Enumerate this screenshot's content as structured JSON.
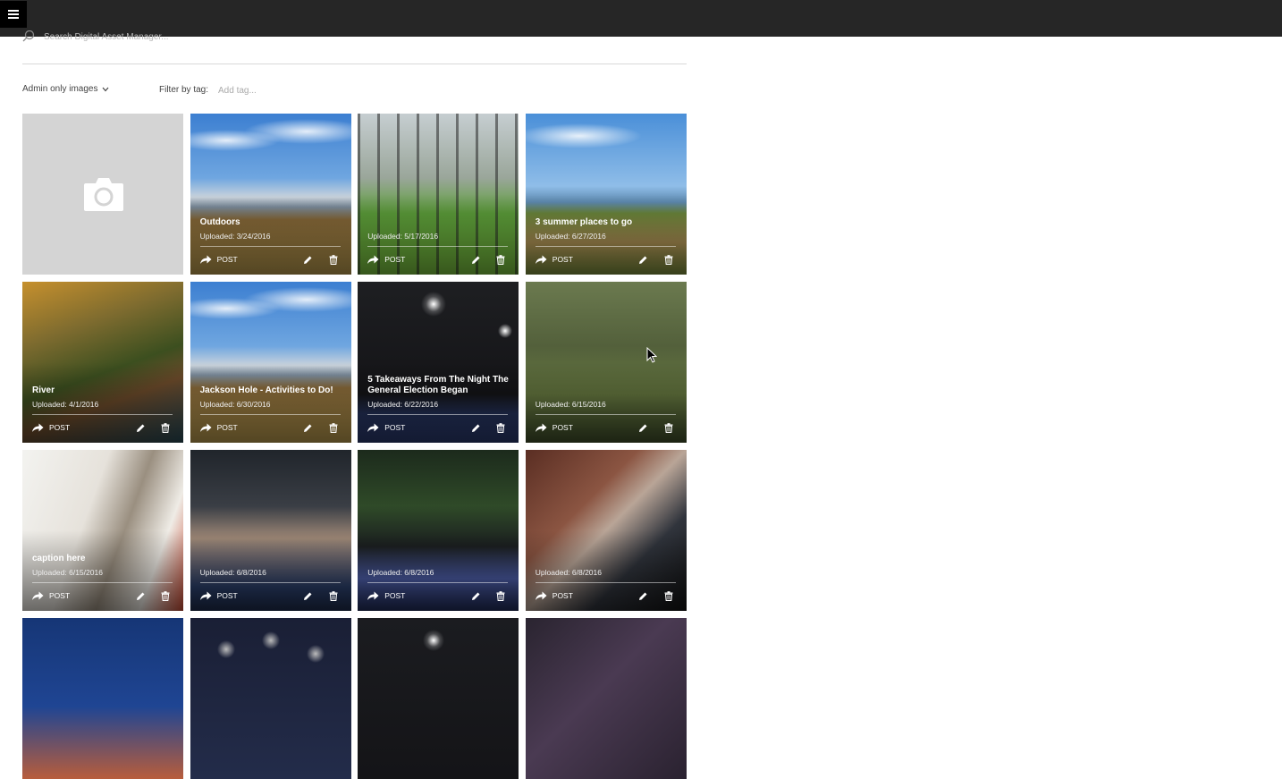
{
  "search": {
    "placeholder": "Search Digital Asset Manager..."
  },
  "filters": {
    "admin_label": "Admin only images",
    "tag_label": "Filter by tag:",
    "tag_placeholder": "Add tag..."
  },
  "post_label": "POST",
  "tiles": [
    {
      "type": "placeholder"
    },
    {
      "bg": "bg-mtn",
      "caption": "Outdoors",
      "uploaded": "Uploaded: 3/24/2016"
    },
    {
      "bg": "bg-park",
      "caption": "",
      "uploaded": "Uploaded: 5/17/2016"
    },
    {
      "bg": "bg-ggb",
      "caption": "3 summer places to go",
      "uploaded": "Uploaded: 6/27/2016"
    },
    {
      "bg": "bg-river",
      "caption": "River",
      "uploaded": "Uploaded: 4/1/2016"
    },
    {
      "bg": "bg-mtn",
      "caption": "Jackson Hole - Activities to Do!",
      "uploaded": "Uploaded: 6/30/2016"
    },
    {
      "bg": "bg-dark1",
      "caption": "5 Takeaways From The Night The General Election Began",
      "uploaded": "Uploaded: 6/22/2016"
    },
    {
      "bg": "bg-feet",
      "caption": "",
      "uploaded": "Uploaded: 6/15/2016"
    },
    {
      "bg": "bg-bride",
      "caption": "caption here",
      "uploaded": "Uploaded: 6/15/2016"
    },
    {
      "bg": "bg-woman",
      "caption": "",
      "uploaded": "Uploaded: 6/8/2016"
    },
    {
      "bg": "bg-bern",
      "caption": "",
      "uploaded": "Uploaded: 6/8/2016"
    },
    {
      "bg": "bg-reid",
      "caption": "",
      "uploaded": "Uploaded: 6/8/2016"
    },
    {
      "bg": "bg-trump",
      "caption": "",
      "uploaded": ""
    },
    {
      "bg": "bg-stars",
      "caption": "",
      "uploaded": ""
    },
    {
      "bg": "bg-dark2",
      "caption": "",
      "uploaded": ""
    },
    {
      "bg": "bg-blue",
      "caption": "",
      "uploaded": ""
    }
  ]
}
